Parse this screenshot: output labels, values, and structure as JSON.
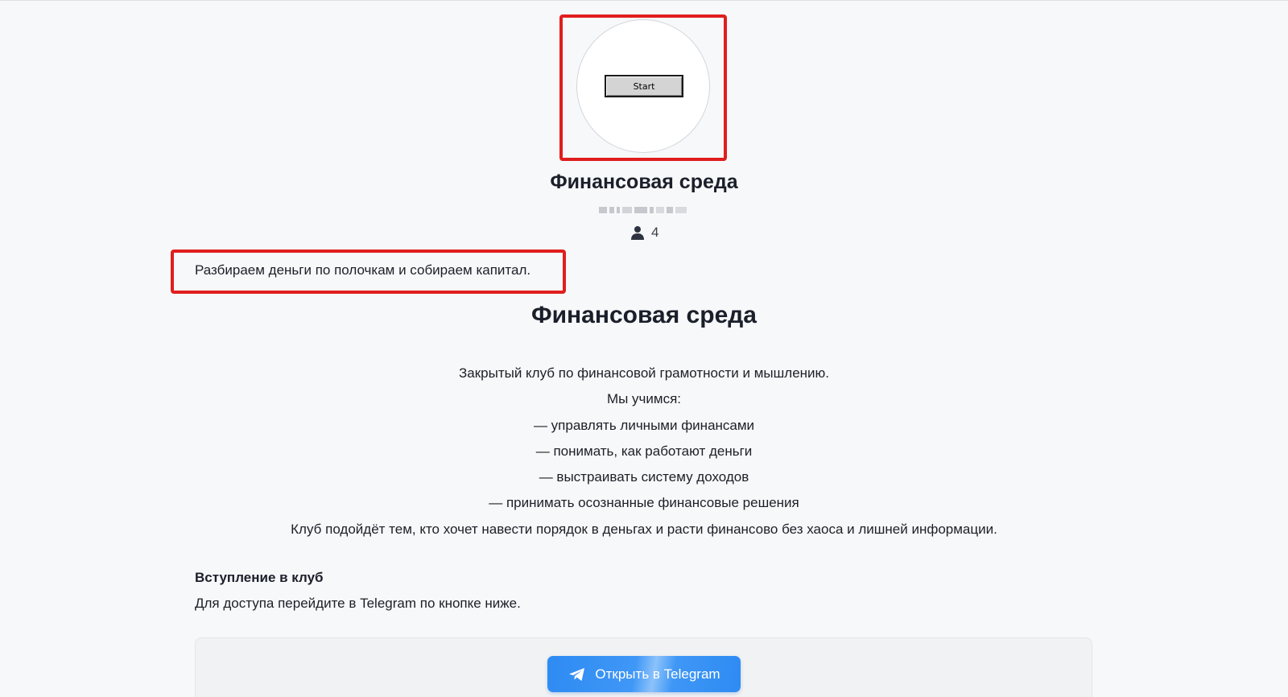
{
  "avatar": {
    "button_label": "Start"
  },
  "club": {
    "title": "Финансовая среда",
    "members_count": "4",
    "tagline": "Разбираем деньги по полочкам и собираем капитал."
  },
  "description": {
    "heading": "Финансовая среда",
    "lines": [
      "Закрытый клуб по финансовой грамотности и мышлению.",
      "Мы учимся:",
      "— управлять личными финансами",
      "— понимать, как работают деньги",
      "— выстраивать систему доходов",
      "— принимать осознанные финансовые решения",
      "Клуб подойдёт тем, кто хочет навести порядок в деньгах и расти финансово без хаоса и лишней информации."
    ]
  },
  "join": {
    "title": "Вступление в клуб",
    "text": "Для доступа перейдите в Telegram по кнопке ниже.",
    "button_label": "Открыть в Telegram"
  },
  "colors": {
    "highlight": "#e01e1e",
    "telegram_blue": "#2e8bf3",
    "background": "#f7f8fa"
  },
  "icons": [
    "person-icon",
    "telegram-icon"
  ]
}
